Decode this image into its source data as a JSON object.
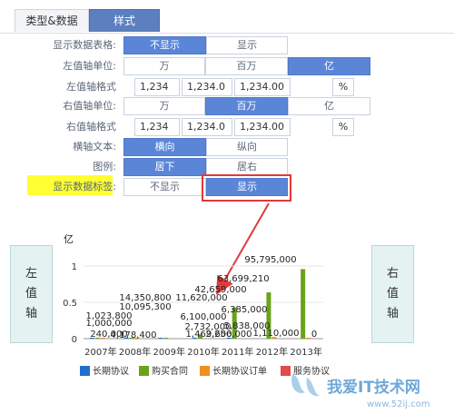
{
  "tabs": [
    {
      "label": "类型&数据"
    },
    {
      "label": "样式"
    }
  ],
  "settings": {
    "show_table": {
      "label": "显示数据表格:",
      "options": [
        "不显示",
        "显示"
      ],
      "selected": 0
    },
    "left_unit": {
      "label": "左值轴单位:",
      "options": [
        "万",
        "百万",
        "亿"
      ],
      "selected": 2
    },
    "left_format": {
      "label": "左值轴格式",
      "values": [
        "1,234",
        "1,234.0",
        "1,234.00"
      ],
      "percent": "%"
    },
    "right_unit": {
      "label": "右值轴单位:",
      "options": [
        "万",
        "百万",
        "亿"
      ],
      "selected": 1
    },
    "right_format": {
      "label": "右值轴格式",
      "values": [
        "1,234",
        "1,234.0",
        "1,234.00"
      ],
      "percent": "%"
    },
    "axis_text": {
      "label": "横轴文本:",
      "options": [
        "横向",
        "纵向"
      ],
      "selected": 0
    },
    "legend": {
      "label": "图例:",
      "options": [
        "居下",
        "居右"
      ],
      "selected": 0
    },
    "show_labels": {
      "label": "显示数据标签:",
      "options": [
        "不显示",
        "显示"
      ],
      "selected": 1
    }
  },
  "side": {
    "left": [
      "左",
      "值",
      "轴"
    ],
    "right": [
      "右",
      "值",
      "轴"
    ]
  },
  "unit_label": "亿",
  "colors": {
    "s1": "#1f6fd0",
    "s2": "#6aa31b",
    "s3": "#f28e1c",
    "s4": "#e34a4a",
    "accent": "#5b86d8",
    "highlight": "#ffff33",
    "callout": "#e03a3a"
  },
  "chart_data": {
    "type": "bar",
    "categories": [
      "2007年",
      "2008年",
      "2009年",
      "2010年",
      "2011年",
      "2012年",
      "2013年"
    ],
    "y_ticks": [
      "0",
      "0.5",
      "1"
    ],
    "ylim": [
      0,
      1
    ],
    "series": [
      {
        "name": "长期协议",
        "values": [
          0.0102,
          0.0143,
          0.0116,
          0.0027,
          0.0015,
          0.0,
          0.0
        ]
      },
      {
        "name": "购买合同",
        "values": [
          0.0024,
          0.0101,
          0.0061,
          0.0583,
          0.4266,
          0.637,
          0.958
        ]
      },
      {
        "name": "长期协议订单",
        "values": [
          0.01,
          0.0042,
          0.0,
          0.0,
          0.0,
          0.0226,
          0.0111
        ]
      },
      {
        "name": "服务协议",
        "values": [
          0.0,
          0.0,
          0.0,
          0.0,
          0.0,
          0.0,
          0.0
        ]
      }
    ],
    "data_labels": [
      "1,023,800",
      "1,000,000",
      "240,000",
      "14,350,800",
      "10,095,300",
      "4,178,400",
      "11,620,000",
      "6,100,000",
      "2,732,000",
      "1,469,600",
      "42,659,000",
      "6,385,000",
      "5,838,000",
      "2,256,000",
      "63,699,210",
      "95,795,000",
      "1,110,000",
      "0"
    ],
    "legend_position": "bottom"
  },
  "watermark": {
    "text": "我爱IT技术网",
    "url": "www.52ij.com"
  }
}
